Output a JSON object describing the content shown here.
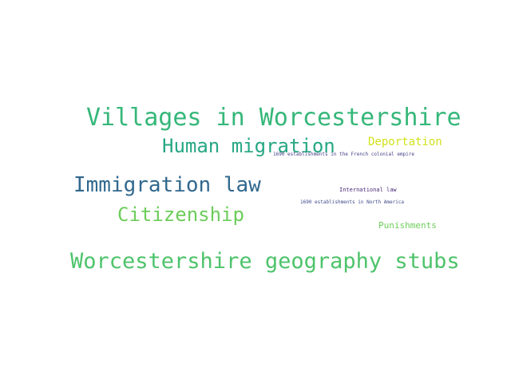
{
  "words": [
    {
      "text": "Villages in Worcestershire",
      "color": "#35b779"
    },
    {
      "text": "Worcestershire geography stubs",
      "color": "#4ec36b"
    },
    {
      "text": "Immigration law",
      "color": "#31688e"
    },
    {
      "text": "Human migration",
      "color": "#26a784"
    },
    {
      "text": "Citizenship",
      "color": "#6ccd5a"
    },
    {
      "text": "Deportation",
      "color": "#d2e21b"
    },
    {
      "text": "Punishments",
      "color": "#6ccd5a"
    },
    {
      "text": "1690 establishments in the French colonial empire",
      "color": "#433e85"
    },
    {
      "text": "International law",
      "color": "#482878"
    },
    {
      "text": "1690 establishments in North America",
      "color": "#3e4a89"
    }
  ]
}
